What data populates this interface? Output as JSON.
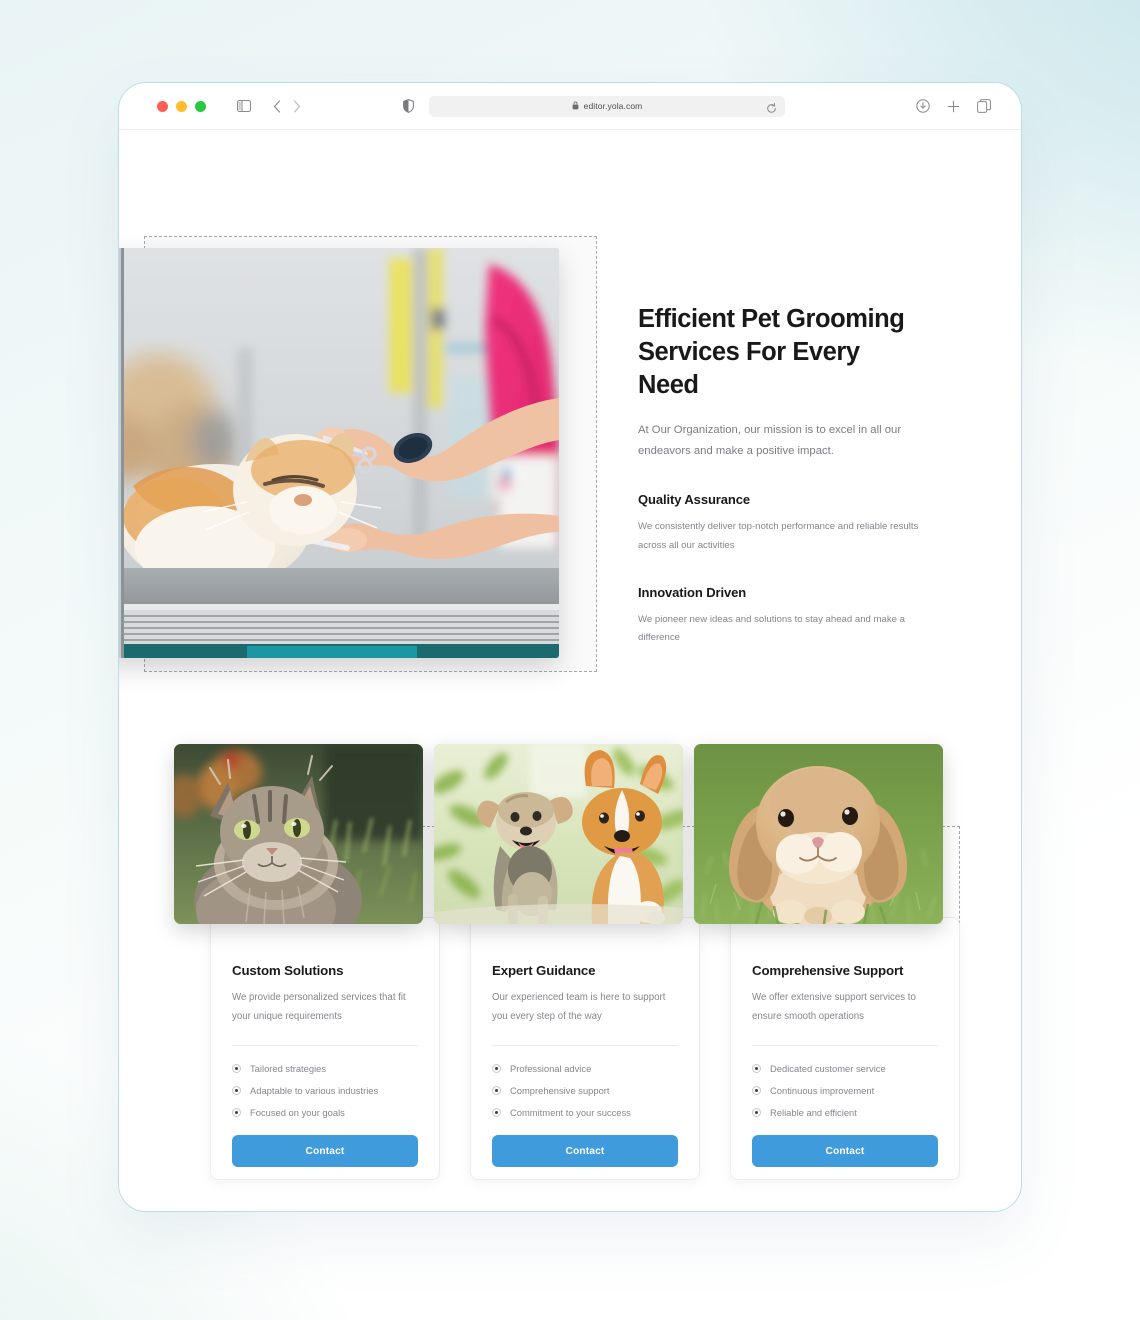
{
  "browser": {
    "traffic_lights": [
      "close",
      "minimize",
      "maximize"
    ],
    "url": "editor.yola.com",
    "lock_icon": "lock-icon",
    "sidebar_icon": "sidebar-toggle-icon",
    "back_icon": "chevron-left-icon",
    "forward_icon": "chevron-right-icon",
    "shield_icon": "privacy-shield-icon",
    "reload_icon": "reload-icon",
    "download_icon": "download-icon",
    "new_tab_icon": "plus-icon",
    "tabs_icon": "tab-overview-icon"
  },
  "hero": {
    "image_alt": "pet-groomer-trimming-cat",
    "title": "Efficient Pet Grooming Services For Every Need",
    "subtitle": "At Our Organization, our mission is to excel in all our endeavors and make a positive impact.",
    "features": [
      {
        "title": "Quality Assurance",
        "description": "We consistently deliver top-notch performance and reliable results across all our activities"
      },
      {
        "title": "Innovation Driven",
        "description": "We pioneer new ideas and solutions to stay ahead and make a difference"
      }
    ]
  },
  "cards": [
    {
      "image_alt": "long-haired-tabby-cat-in-grass",
      "title": "Custom Solutions",
      "description": "We provide personalized services that fit your unique requirements",
      "bullets": [
        "Tailored strategies",
        "Adaptable to various industries",
        "Focused on your goals"
      ],
      "button_label": "Contact"
    },
    {
      "image_alt": "two-happy-dogs-terrier-and-corgi",
      "title": "Expert Guidance",
      "description": "Our experienced team is here to support you every step of the way",
      "bullets": [
        "Professional advice",
        "Comprehensive support",
        "Commitment to your success"
      ],
      "button_label": "Contact"
    },
    {
      "image_alt": "lop-eared-rabbit-on-grass",
      "title": "Comprehensive Support",
      "description": "We offer extensive support services to ensure smooth operations",
      "bullets": [
        "Dedicated customer service",
        "Continuous improvement",
        "Reliable and efficient"
      ],
      "button_label": "Contact"
    }
  ],
  "colors": {
    "button_blue": "#3f9bdc",
    "window_border": "#b9dcec",
    "heading": "#19191b",
    "body_text": "#85858c",
    "selection_dash": "#a8a8a8"
  }
}
